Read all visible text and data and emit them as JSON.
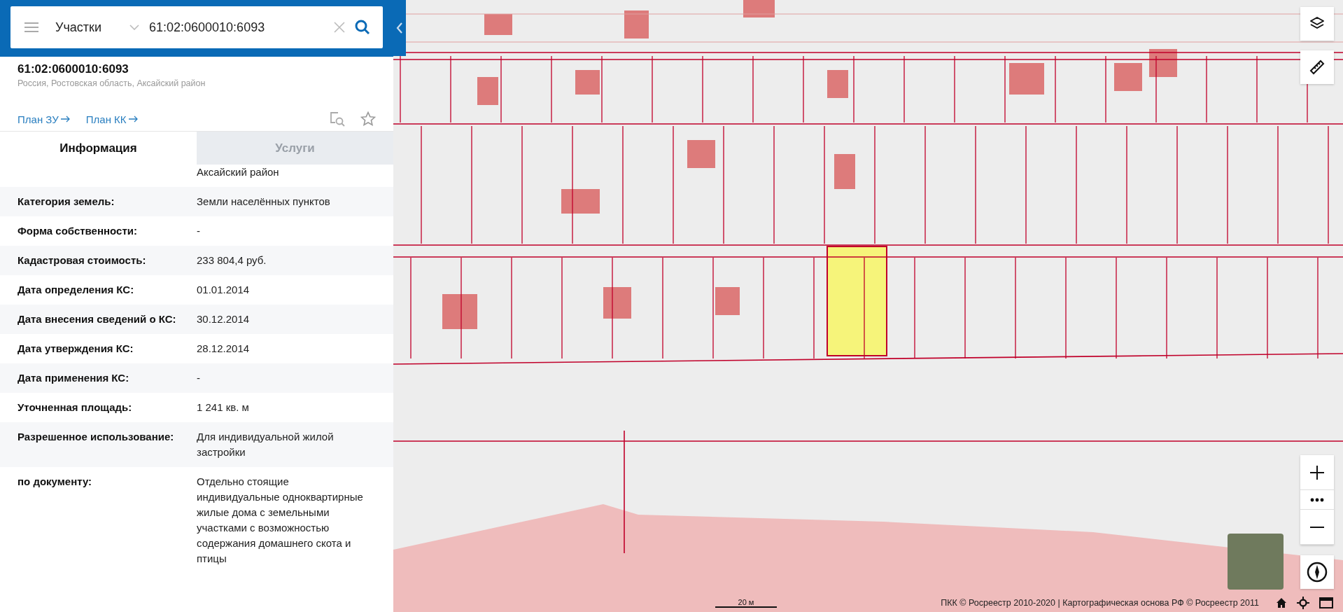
{
  "search": {
    "category": "Участки",
    "value": "61:02:0600010:6093"
  },
  "parcel": {
    "number": "61:02:0600010:6093",
    "address": "Россия, Ростовская область, Аксайский район"
  },
  "links": [
    "План ЗУ",
    "План КК"
  ],
  "tabs": [
    {
      "label": "Информация",
      "selected": true
    },
    {
      "label": "Услуги",
      "selected": false
    }
  ],
  "rows": [
    {
      "value": "Аксайский район"
    },
    {
      "label": "Категория земель:",
      "value": "Земли населённых пунктов"
    },
    {
      "label": "Форма собственности:",
      "value": "-"
    },
    {
      "label": "Кадастровая стоимость:",
      "value": "233 804,4 руб."
    },
    {
      "label": "Дата определения КС:",
      "value": "01.01.2014"
    },
    {
      "label": "Дата внесения сведений о КС:",
      "value": "30.12.2014"
    },
    {
      "label": "Дата утверждения КС:",
      "value": "28.12.2014"
    },
    {
      "label": "Дата применения КС:",
      "value": "-"
    },
    {
      "label": "Уточненная площадь:",
      "value": "1 241 кв. м"
    },
    {
      "label": "Разрешенное использование:",
      "value": "Для индивидуальной жилой застройки"
    },
    {
      "label": "по документу:",
      "value": "Отдельно стоящие индивидуальные одноквартирные жилые дома с земельными участками с возможностью содержания домашнего скота и птицы"
    }
  ],
  "map": {
    "scale": "20 м",
    "attribution": "ПКК © Росреестр 2010-2020 | Картографическая основа РФ © Росреестр 2011"
  }
}
